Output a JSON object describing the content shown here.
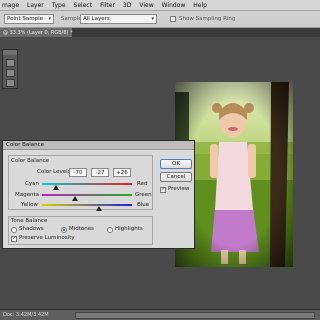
{
  "menu": [
    "mage",
    "Layer",
    "Type",
    "Select",
    "Filter",
    "3D",
    "View",
    "Window",
    "Help"
  ],
  "options": {
    "sample_select": "Point Sample",
    "sample_label": "Sample:",
    "layers_select": "All Layers",
    "show_ring_label": "Show Sampling Ring"
  },
  "document_tab": "@ 33.3% (Layer 0, RGB/8) *",
  "status": {
    "doc": "Doc: 3.42M/3.42M"
  },
  "dialog": {
    "title": "Color Balance",
    "color_balance_group": "Color Balance",
    "color_levels_label": "Color Levels:",
    "levels": [
      "-70",
      "-27",
      "+26"
    ],
    "sliders": [
      {
        "left": "Cyan",
        "right": "Red",
        "value": -70,
        "gradient": [
          "#00c8d8",
          "#e02020"
        ]
      },
      {
        "left": "Magenta",
        "right": "Green",
        "value": -27,
        "gradient": [
          "#c020c0",
          "#20b020"
        ]
      },
      {
        "left": "Yellow",
        "right": "Blue",
        "value": 26,
        "gradient": [
          "#d8d000",
          "#2020d0"
        ]
      }
    ],
    "tone_group": "Tone Balance",
    "tones": [
      "Shadows",
      "Midtones",
      "Highlights"
    ],
    "tone_selected": "Midtones",
    "preserve_label": "Preserve Luminosity",
    "ok_label": "OK",
    "cancel_label": "Cancel",
    "preview_label": "Preview"
  }
}
